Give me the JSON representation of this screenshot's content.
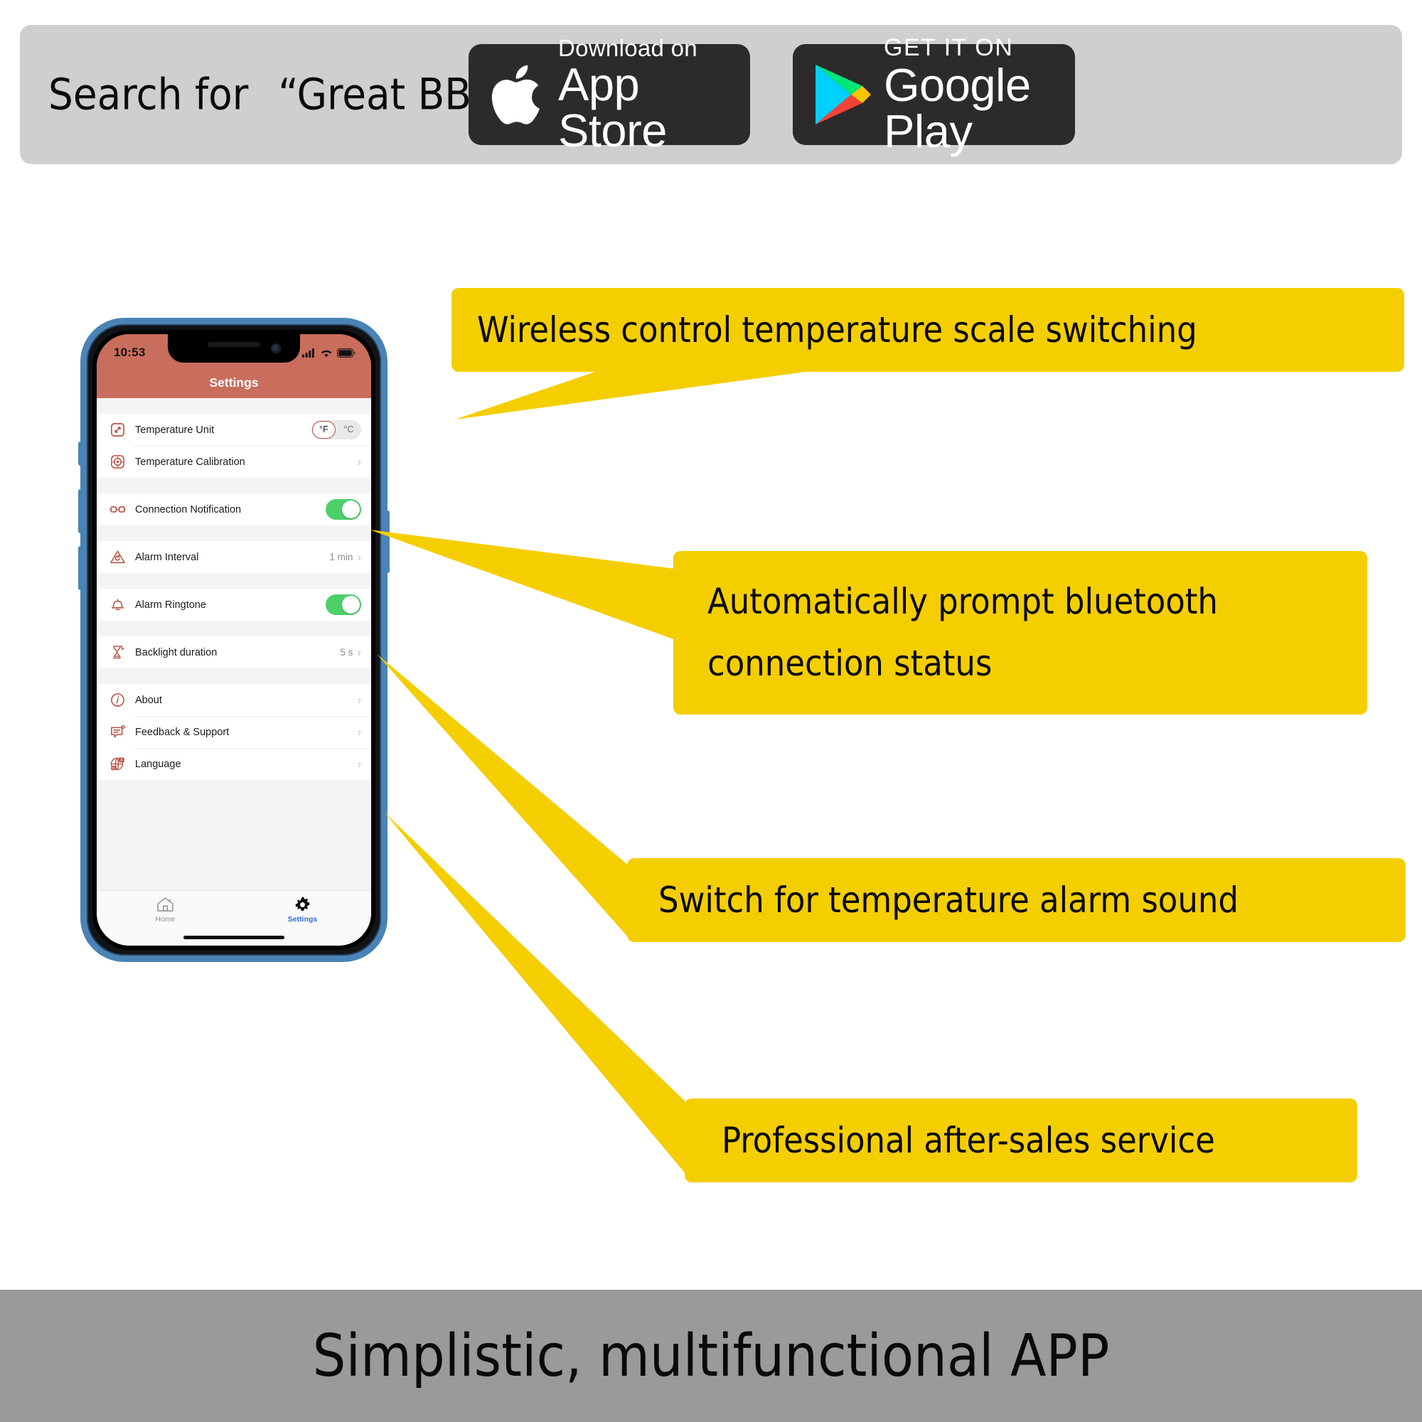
{
  "header": {
    "search_prefix": "Search for",
    "search_query": "“Great BBQ”",
    "appstore": {
      "small": "Download on",
      "big": "App Store",
      "icon": "apple-logo-icon"
    },
    "googleplay": {
      "small": "GET IT ON",
      "big": "Google Play",
      "icon": "google-play-logo-icon"
    }
  },
  "phone": {
    "status": {
      "time": "10:53",
      "cellular_icon": "signal-bars-icon",
      "wifi_icon": "wifi-icon",
      "battery_icon": "battery-full-icon"
    },
    "navbar_title": "Settings",
    "groups": [
      {
        "rows": [
          {
            "icon": "temperature-unit-icon",
            "label": "Temperature Unit",
            "control": "segmented",
            "options": [
              "°F",
              "°C"
            ],
            "selected": "°F"
          },
          {
            "icon": "calibration-target-icon",
            "label": "Temperature Calibration",
            "control": "chevron",
            "value": ""
          }
        ]
      },
      {
        "rows": [
          {
            "icon": "bluetooth-link-icon",
            "label": "Connection Notification",
            "control": "toggle",
            "toggle_on": true
          }
        ]
      },
      {
        "rows": [
          {
            "icon": "alarm-interval-icon",
            "label": "Alarm Interval",
            "control": "chevron",
            "value": "1 min"
          }
        ]
      },
      {
        "rows": [
          {
            "icon": "bell-icon",
            "label": "Alarm Ringtone",
            "control": "toggle",
            "toggle_on": true
          }
        ]
      },
      {
        "rows": [
          {
            "icon": "backlight-hourglass-icon",
            "label": "Backlight duration",
            "control": "chevron",
            "value": "5 s"
          }
        ]
      },
      {
        "rows": [
          {
            "icon": "info-circle-icon",
            "label": "About",
            "control": "chevron",
            "value": ""
          },
          {
            "icon": "feedback-message-icon",
            "label": "Feedback & Support",
            "control": "chevron",
            "value": ""
          },
          {
            "icon": "language-globe-icon",
            "label": "Language",
            "control": "chevron",
            "value": ""
          }
        ]
      }
    ],
    "tabs": [
      {
        "icon": "home-icon",
        "label": "Home",
        "active": false
      },
      {
        "icon": "gear-icon",
        "label": "Settings",
        "active": true
      }
    ]
  },
  "callouts": [
    {
      "text": "Wireless control temperature scale switching"
    },
    {
      "line1": "Automatically prompt bluetooth",
      "line2": "connection status"
    },
    {
      "text": "Switch for temperature alarm sound"
    },
    {
      "text": "Professional after-sales service"
    }
  ],
  "footer": {
    "text": "Simplistic, multifunctional APP"
  },
  "colors": {
    "callout_yellow": "#F5CE00",
    "header_gray": "#cfcfcf",
    "footer_gray": "#9a9a9a",
    "app_accent_red": "#c96d5c",
    "icon_red": "#b5503f",
    "toggle_green": "#4bd06a",
    "tab_active_blue": "#2a6fd6"
  }
}
